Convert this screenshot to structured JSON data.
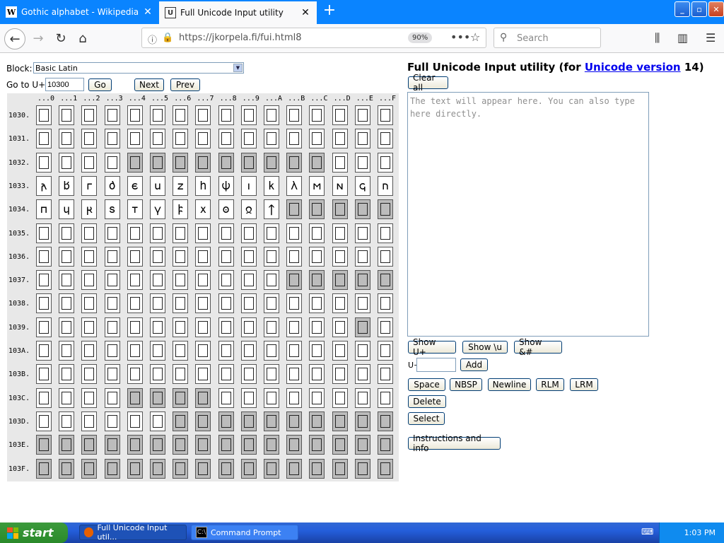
{
  "browser": {
    "tabs": [
      {
        "title": "Gothic alphabet - Wikipedia",
        "favicon": "W",
        "active": false
      },
      {
        "title": "Full Unicode Input utility",
        "favicon": "U",
        "active": true
      }
    ],
    "new_tab": "+",
    "window_controls": {
      "minimize": "_",
      "maximize": "▫",
      "close": "✕"
    },
    "url": "https://jkorpela.fi/fui.html8",
    "zoom": "90%",
    "search_placeholder": "Search"
  },
  "page": {
    "block_label": "Block:",
    "block_value": "Basic Latin",
    "goto_label": "Go to U+",
    "goto_value": "10300",
    "go_button": "Go",
    "next_button": "Next",
    "prev_button": "Prev",
    "heading_prefix": "Full Unicode Input utility (for",
    "heading_link": "Unicode version",
    "heading_suffix": "14)",
    "clear_button": "Clear all",
    "textarea_placeholder": "The text will appear here. You can also type here directly.",
    "show_uplus": "Show U+",
    "show_u": "Show \\u",
    "show_amp": "Show &#",
    "uplus_label": "U+",
    "add_button": "Add",
    "space_button": "Space",
    "nbsp_button": "NBSP",
    "newline_button": "Newline",
    "rlm_button": "RLM",
    "lrm_button": "LRM",
    "delete_button": "Delete",
    "select_button": "Select",
    "instructions_button": "Instructions and info"
  },
  "grid": {
    "column_headers": [
      "...0",
      "...1",
      "...2",
      "...3",
      "...4",
      "...5",
      "...6",
      "...7",
      "...8",
      "...9",
      "...A",
      "...B",
      "...C",
      "...D",
      "...E",
      "...F"
    ],
    "row_headers": [
      "1030.",
      "1031.",
      "1032.",
      "1033.",
      "1034.",
      "1035.",
      "1036.",
      "1037.",
      "1038.",
      "1039.",
      "103A.",
      "103B.",
      "103C.",
      "103D.",
      "103E.",
      "103F."
    ],
    "gothic_row_1033": [
      "𐌰",
      "𐌱",
      "𐌲",
      "𐌳",
      "𐌴",
      "𐌵",
      "𐌶",
      "𐌷",
      "𐌸",
      "𐌹",
      "𐌺",
      "𐌻",
      "𐌼",
      "𐌽",
      "𐌾",
      "𐌿"
    ],
    "gothic_row_1034": [
      "𐍀",
      "𐍁",
      "𐍂",
      "𐍃",
      "𐍄",
      "𐍅",
      "𐍆",
      "𐍇",
      "𐍈",
      "𐍉",
      "𐍊"
    ],
    "grey_cells": {
      "1032.": [
        4,
        5,
        6,
        7,
        8,
        9,
        10,
        11,
        12
      ],
      "1034.": [
        11,
        12,
        13,
        14,
        15
      ],
      "1037.": [
        11,
        12,
        13,
        14,
        15
      ],
      "1039.": [
        14
      ],
      "103C.": [
        4,
        5,
        6,
        7
      ],
      "103D.": [
        6,
        7,
        8,
        9,
        10,
        11,
        12,
        13,
        14,
        15
      ],
      "103E.": [
        0,
        1,
        2,
        3,
        4,
        5,
        6,
        7,
        8,
        9,
        10,
        11,
        12,
        13,
        14,
        15
      ],
      "103F.": [
        0,
        1,
        2,
        3,
        4,
        5,
        6,
        7,
        8,
        9,
        10,
        11,
        12,
        13,
        14,
        15
      ]
    }
  },
  "taskbar": {
    "start": "start",
    "items": [
      {
        "label": "Full Unicode Input util...",
        "active": true
      },
      {
        "label": "Command Prompt",
        "active": false
      }
    ],
    "clock": "1:03 PM"
  }
}
